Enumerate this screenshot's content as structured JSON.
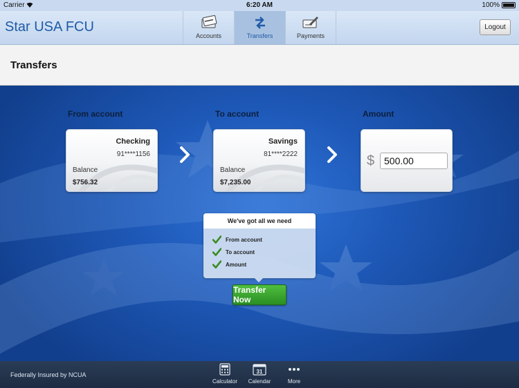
{
  "status_bar": {
    "carrier": "Carrier",
    "time": "6:20 AM",
    "battery": "100%"
  },
  "header": {
    "brand": "Star USA FCU",
    "tabs": [
      {
        "label": "Accounts",
        "icon": "accounts-icon",
        "active": false
      },
      {
        "label": "Transfers",
        "icon": "transfers-icon",
        "active": true
      },
      {
        "label": "Payments",
        "icon": "payments-icon",
        "active": false
      }
    ],
    "logout_label": "Logout"
  },
  "page": {
    "title": "Transfers"
  },
  "transfer": {
    "from_label": "From account",
    "to_label": "To account",
    "amount_label": "Amount",
    "from_account": {
      "name": "Checking",
      "number": "91****1156",
      "balance_label": "Balance",
      "balance": "$756.32"
    },
    "to_account": {
      "name": "Savings",
      "number": "81****2222",
      "balance_label": "Balance",
      "balance": "$7,235.00"
    },
    "currency_symbol": "$",
    "amount_value": "500.00"
  },
  "checklist": {
    "title": "We've got all we need",
    "items": [
      "From account",
      "To account",
      "Amount"
    ]
  },
  "transfer_button": "Transfer Now",
  "footer": {
    "insured_text": "Federally Insured by NCUA",
    "tools": [
      {
        "label": "Calculator",
        "icon": "calculator-icon"
      },
      {
        "label": "Calendar",
        "icon": "calendar-icon",
        "day": "31"
      },
      {
        "label": "More",
        "icon": "more-icon"
      }
    ]
  },
  "colors": {
    "brand": "#1f5aa8",
    "button_green": "#2a8f22",
    "check_green": "#3a8a1f"
  }
}
